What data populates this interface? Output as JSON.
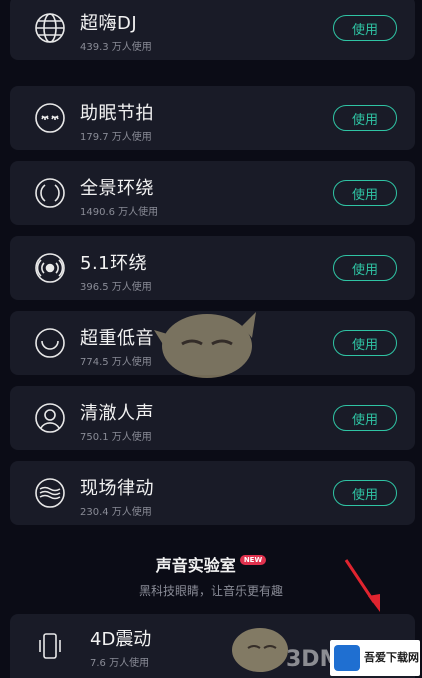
{
  "effects": [
    {
      "title": "超嗨DJ",
      "users": "439.3 万人使用",
      "button": "使用",
      "icon": "globe-icon"
    },
    {
      "title": "助眠节拍",
      "users": "179.7 万人使用",
      "button": "使用",
      "icon": "sleep-face-icon"
    },
    {
      "title": "全景环绕",
      "users": "1490.6 万人使用",
      "button": "使用",
      "icon": "panorama-ring-icon"
    },
    {
      "title": "5.1环绕",
      "users": "396.5 万人使用",
      "button": "使用",
      "icon": "surround-speaker-icon"
    },
    {
      "title": "超重低音",
      "users": "774.5 万人使用",
      "button": "使用",
      "icon": "bass-circle-icon"
    },
    {
      "title": "清澈人声",
      "users": "750.1 万人使用",
      "button": "使用",
      "icon": "person-icon"
    },
    {
      "title": "现场律动",
      "users": "230.4 万人使用",
      "button": "使用",
      "icon": "wave-lines-icon"
    }
  ],
  "lab": {
    "heading": "声音实验室",
    "badge": "NEW",
    "subtitle": "黑科技眼睛，让音乐更有趣"
  },
  "vibrate": {
    "title": "4D震动",
    "users": "7.6 万人使用",
    "icon": "phone-vibrate-icon"
  },
  "watermark": {
    "text": "3DM",
    "site_name": "吾爱下载网"
  },
  "colors": {
    "background": "#0b0c16",
    "card": "#191b27",
    "accent": "#2fc4a4",
    "arrow": "#e0242f"
  }
}
